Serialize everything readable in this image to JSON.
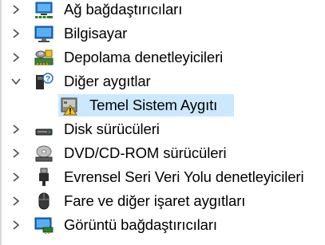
{
  "device_tree": {
    "items": [
      {
        "label": "Ağ bağdaştırıcıları",
        "icon": "network-adapter-icon",
        "expanded": false
      },
      {
        "label": "Bilgisayar",
        "icon": "computer-monitor-icon",
        "expanded": false
      },
      {
        "label": "Depolama denetleyicileri",
        "icon": "storage-controller-icon",
        "expanded": false
      },
      {
        "label": "Diğer aygıtlar",
        "icon": "other-devices-icon",
        "expanded": true,
        "children": [
          {
            "label": "Temel Sistem Aygıtı",
            "icon": "unknown-device-warning-icon",
            "selected": true
          }
        ]
      },
      {
        "label": "Disk sürücüleri",
        "icon": "disk-drive-icon",
        "expanded": false
      },
      {
        "label": "DVD/CD-ROM sürücüleri",
        "icon": "optical-drive-icon",
        "expanded": false
      },
      {
        "label": "Evrensel Seri Veri Yolu denetleyicileri",
        "icon": "usb-plug-icon",
        "expanded": false
      },
      {
        "label": "Fare ve diğer işaret aygıtları",
        "icon": "mouse-icon",
        "expanded": false
      },
      {
        "label": "Görüntü bağdaştırıcıları",
        "icon": "display-adapter-icon",
        "expanded": false
      }
    ]
  },
  "colors": {
    "selection": "#cce8ff",
    "chevron": "#4d4d4d"
  }
}
